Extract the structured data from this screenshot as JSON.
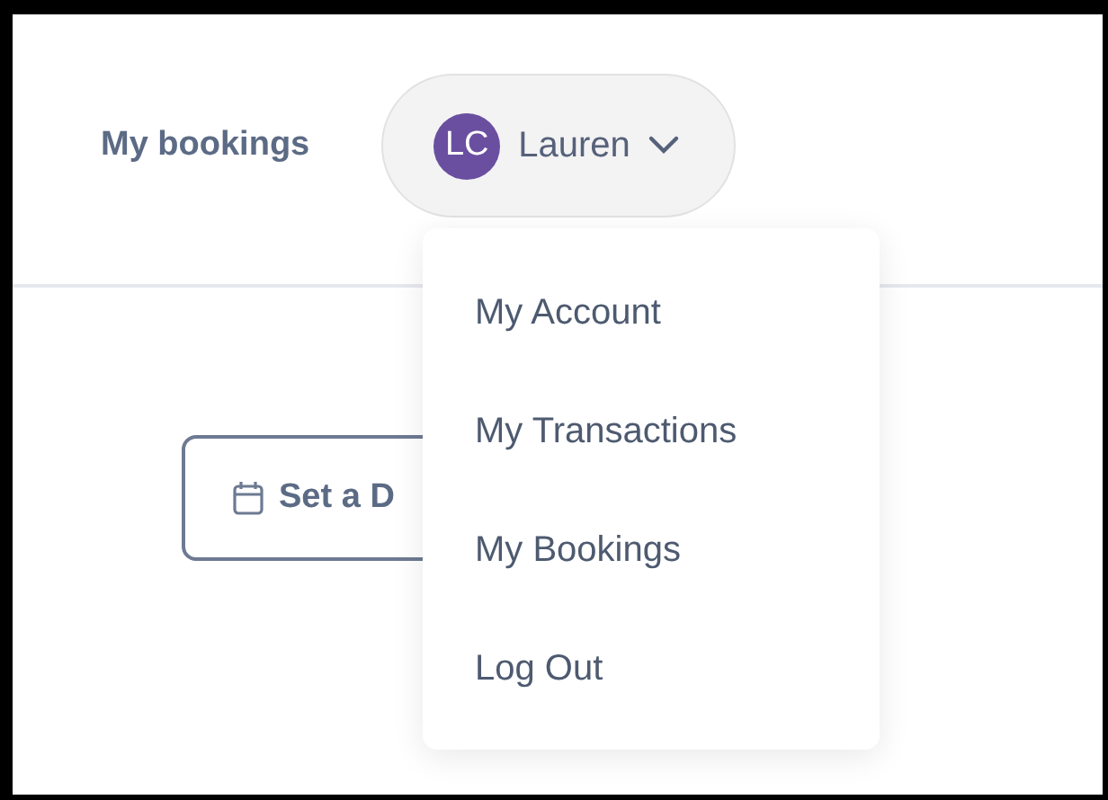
{
  "nav": {
    "link": "My bookings",
    "user": {
      "initials": "LC",
      "name": "Lauren",
      "expanded": true
    }
  },
  "menu": [
    {
      "label": "My Account"
    },
    {
      "label": "My Transactions"
    },
    {
      "label": "My Bookings"
    },
    {
      "label": "Log Out"
    }
  ],
  "date_button": {
    "label": "Set a D"
  }
}
